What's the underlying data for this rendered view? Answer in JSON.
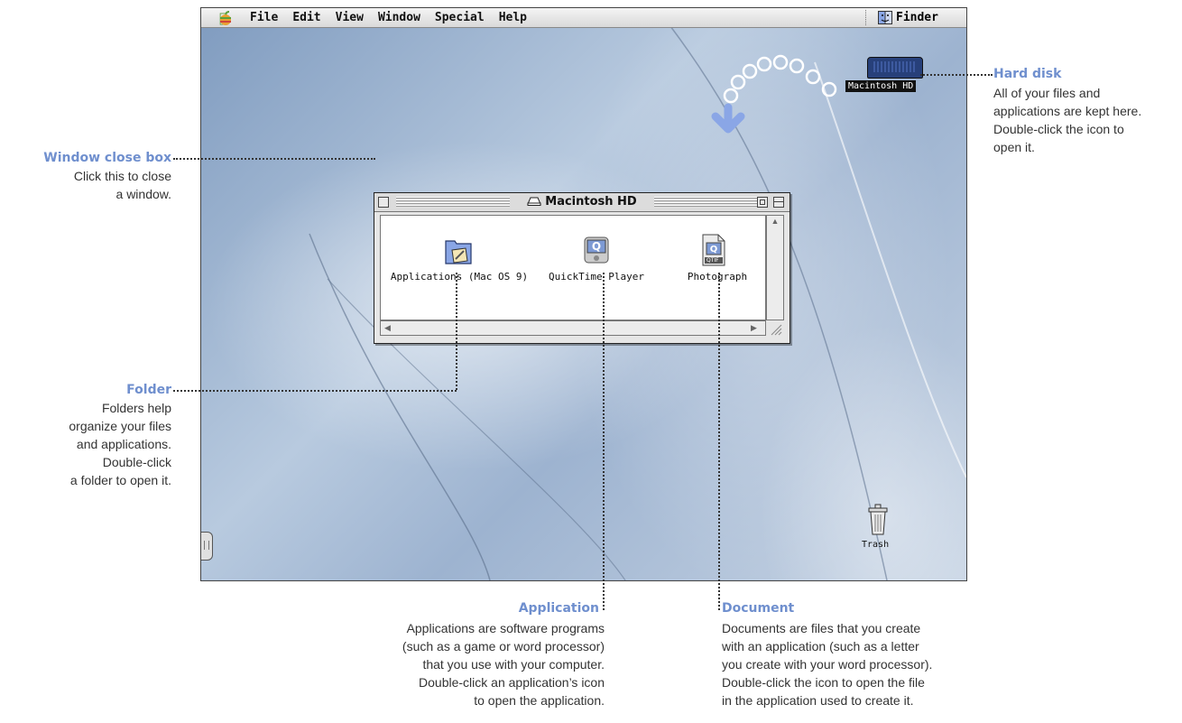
{
  "menubar": {
    "items": [
      "File",
      "Edit",
      "View",
      "Window",
      "Special",
      "Help"
    ],
    "app_menu": "Finder"
  },
  "window": {
    "title": "Macintosh HD",
    "icons": [
      {
        "label": "Applications (Mac OS 9)",
        "icon": "folder-icon"
      },
      {
        "label": "QuickTime Player",
        "icon": "quicktime-icon"
      },
      {
        "label": "Photograph",
        "icon": "document-icon",
        "badge": "QTIF"
      }
    ]
  },
  "desktop": {
    "hard_disk_label": "Macintosh HD",
    "trash_label": "Trash"
  },
  "callouts": {
    "close_box": {
      "title": "Window close box",
      "body": [
        "Click this to close",
        "a window."
      ]
    },
    "hard_disk": {
      "title": "Hard disk",
      "body": [
        "All of your files and",
        "applications are kept here.",
        "Double-click the icon to",
        "open it."
      ]
    },
    "folder": {
      "title": "Folder",
      "body": [
        "Folders help",
        "organize your files",
        "and applications.",
        "Double-click",
        "a folder to open it."
      ]
    },
    "application": {
      "title": "Application",
      "body": [
        "Applications are software programs",
        "(such as a game or word processor)",
        "that you use with your computer.",
        "Double-click an application’s icon",
        "to open the application."
      ]
    },
    "document": {
      "title": "Document",
      "body": [
        "Documents are files that you create",
        "with an application (such as a letter",
        "you create with your word processor).",
        "Double-click the icon to open the file",
        "in the application used to create it."
      ]
    }
  },
  "colors": {
    "callout_title": "#6f8fce",
    "arrow": "#8aa6e6"
  }
}
